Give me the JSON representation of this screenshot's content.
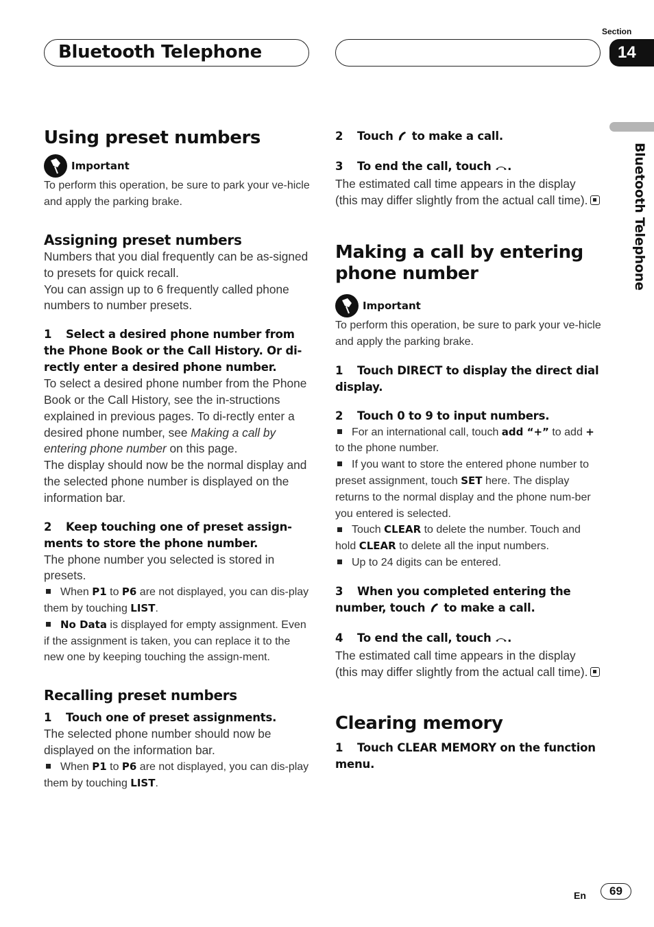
{
  "header": {
    "title": "Bluetooth Telephone",
    "section_label": "Section",
    "section_number": "14",
    "side_tab": "Bluetooth Telephone"
  },
  "left": {
    "h1": "Using preset numbers",
    "important_label": "Important",
    "important_text": "To perform this operation, be sure to park your ve-hicle and apply the parking brake.",
    "assign": {
      "h2": "Assigning preset numbers",
      "intro1": "Numbers that you dial frequently can be as-signed to presets for quick recall.",
      "intro2": "You can assign up to 6 frequently called phone numbers to number presets.",
      "step1_num": "1",
      "step1": "Select a desired phone number from the Phone Book or the Call History. Or di-rectly enter a desired phone number.",
      "step1_body_a": "To select a desired phone number from the Phone Book or the Call History, see the in-structions explained in previous pages. To di-rectly enter a desired phone number, see ",
      "step1_body_italic": "Making a call by entering phone number",
      "step1_body_b": " on this page.",
      "step1_body2": "The display should now be the normal display and the selected phone number is displayed on the information bar.",
      "step2_num": "2",
      "step2": "Keep touching one of preset assign-ments to store the phone number.",
      "step2_body": "The phone number you selected is stored in presets.",
      "bullet1": {
        "a": "When ",
        "b1": "P1",
        "c": " to ",
        "b2": "P6",
        "d": " are not displayed, you can dis-play them by touching ",
        "b3": "LIST",
        "e": "."
      },
      "bullet2": {
        "b1": "No Data",
        "a": " is displayed for empty assignment. Even if the assignment is taken, you can replace it to the new one by keeping touching the assign-ment."
      }
    },
    "recall": {
      "h2": "Recalling preset numbers",
      "step1_num": "1",
      "step1": "Touch one of preset assignments.",
      "step1_body": "The selected phone number should now be displayed on the information bar.",
      "bullet1": {
        "a": "When ",
        "b1": "P1",
        "c": " to ",
        "b2": "P6",
        "d": " are not displayed, you can dis-play them by touching ",
        "b3": "LIST",
        "e": "."
      }
    }
  },
  "right": {
    "cont_step2_num": "2",
    "cont_step2_a": "Touch ",
    "cont_step2_b": " to make a call.",
    "cont_step3_num": "3",
    "cont_step3_a": "To end the call, touch ",
    "cont_step3_b": ".",
    "cont_step3_body": "The estimated call time appears in the display (this may differ slightly from the actual call time).",
    "making": {
      "h1": "Making a call by entering phone number",
      "important_label": "Important",
      "important_text": "To perform this operation, be sure to park your ve-hicle and apply the parking brake.",
      "step1_num": "1",
      "step1": "Touch DIRECT to display the direct dial display.",
      "step2_num": "2",
      "step2": "Touch 0 to 9 to input numbers.",
      "bullet1": {
        "a": "For an international call, touch ",
        "b1": "add “+”",
        "c": " to add ",
        "b2": "+",
        "d": " to the phone number."
      },
      "bullet2": {
        "a": "If you want to store the entered phone number to preset assignment, touch ",
        "b1": "SET",
        "c": " here. The display returns to the normal display and the phone num-ber you entered is selected."
      },
      "bullet3": {
        "a": "Touch ",
        "b1": "CLEAR",
        "c": " to delete the number. Touch and hold ",
        "b2": "CLEAR",
        "d": " to delete all the input numbers."
      },
      "bullet4": "Up to 24 digits can be entered.",
      "step3_num": "3",
      "step3_a": "When you completed entering the number, touch ",
      "step3_b": " to make a call.",
      "step4_num": "4",
      "step4_a": "To end the call, touch ",
      "step4_b": ".",
      "step4_body": "The estimated call time appears in the display (this may differ slightly from the actual call time)."
    },
    "clearing": {
      "h1": "Clearing memory",
      "step1_num": "1",
      "step1": "Touch CLEAR MEMORY on the function menu."
    }
  },
  "footer": {
    "lang": "En",
    "page": "69"
  }
}
